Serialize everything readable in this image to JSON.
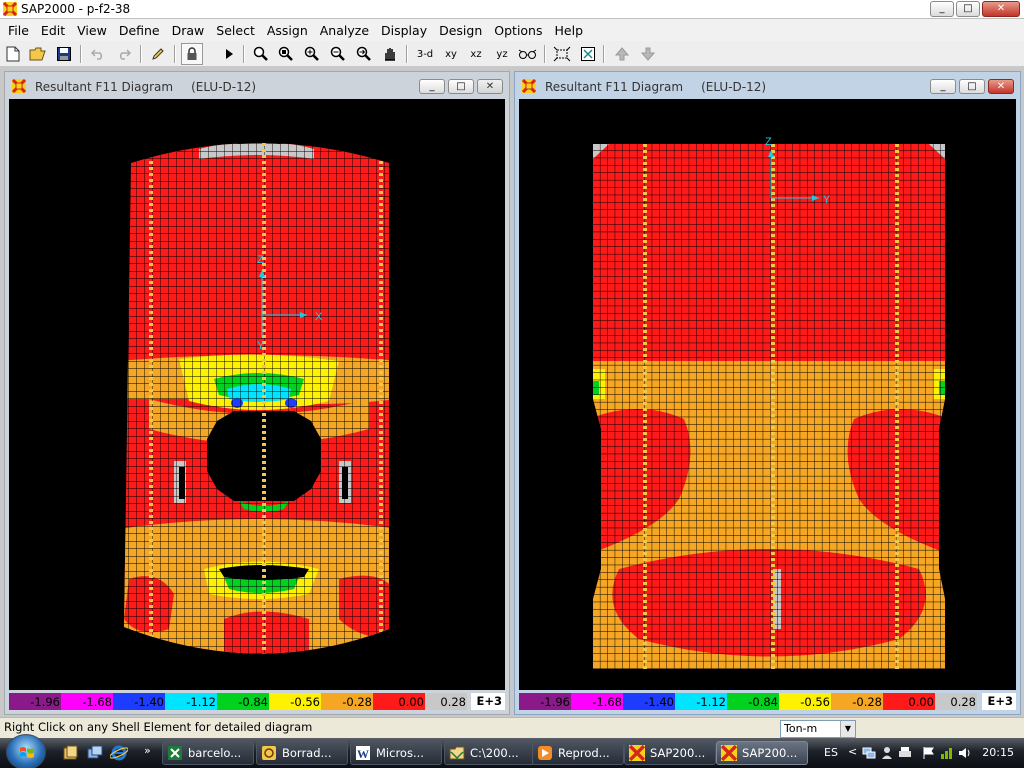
{
  "app": {
    "title": "SAP2000 - p-f2-38",
    "window_buttons": {
      "minimize": "_",
      "maximize": "□",
      "close": "✕"
    }
  },
  "menu": [
    "File",
    "Edit",
    "View",
    "Define",
    "Draw",
    "Select",
    "Assign",
    "Analyze",
    "Display",
    "Design",
    "Options",
    "Help"
  ],
  "toolbar": {
    "view_3d": "3-d",
    "view_xy": "xy",
    "view_xz": "xz",
    "view_yz": "yz",
    "icons": [
      "new-icon",
      "open-icon",
      "save-icon",
      "undo-icon",
      "redo-icon",
      "pencil-icon",
      "lock-icon",
      "run-icon",
      "zoom-window-icon",
      "zoom-restore-icon",
      "zoom-in-icon",
      "zoom-out-icon",
      "zoom-previous-icon",
      "pan-icon",
      "set-display-icon",
      "rubber-band-icon",
      "perspective-icon",
      "up-arrow-icon",
      "down-arrow-icon"
    ]
  },
  "views": {
    "left": {
      "title": "Resultant F11 Diagram",
      "case": "(ELU-D-12)",
      "axes": {
        "x": "X",
        "y": "Y",
        "z": "Z"
      }
    },
    "right": {
      "title": "Resultant F11 Diagram",
      "case": "(ELU-D-12)",
      "axes": {
        "y": "Y",
        "z": "Z"
      }
    }
  },
  "legend": {
    "unit": "E+3",
    "values": [
      "-1.96",
      "-1.68",
      "-1.40",
      "-1.12",
      "-0.84",
      "-0.56",
      "-0.28",
      "0.00",
      "0.28"
    ],
    "colors": [
      "#8a1a8a",
      "#ff00ff",
      "#1e3cff",
      "#00e5ff",
      "#00d21e",
      "#fff200",
      "#f5a623",
      "#ff1a1a",
      "#c8c8c8"
    ],
    "unit_bg": "#ffffff"
  },
  "status": {
    "message": "Right Click on any Shell Element for detailed diagram",
    "units": "Ton-m"
  },
  "taskbar": {
    "tasks": [
      {
        "label": "barcelo...",
        "icon": "excel-icon"
      },
      {
        "label": "Borrad...",
        "icon": "draft-icon"
      },
      {
        "label": "Micros...",
        "icon": "word-icon"
      },
      {
        "label": "C:\\200...",
        "icon": "folder-icon"
      },
      {
        "label": "Reprod...",
        "icon": "player-icon"
      },
      {
        "label": "SAP200...",
        "icon": "sap-icon"
      },
      {
        "label": "SAP200...",
        "icon": "sap-icon"
      }
    ],
    "language": "ES",
    "clock": "20:15"
  },
  "colors": {
    "red": "#ff1a1a",
    "orange": "#f5a623",
    "yellow": "#fff200",
    "green": "#00d21e",
    "cyan": "#00e5ff",
    "blue": "#1e3cff",
    "grey": "#c8c8c8",
    "axis": "#22c8e0"
  }
}
